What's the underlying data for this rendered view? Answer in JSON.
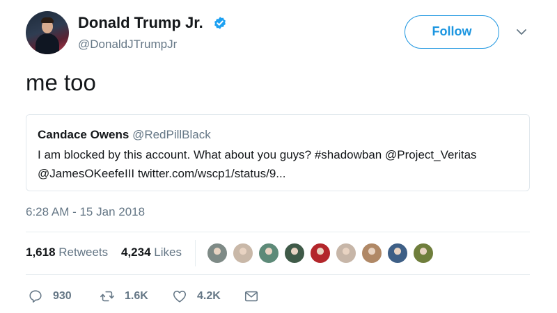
{
  "author": {
    "name": "Donald Trump Jr.",
    "handle": "@DonaldJTrumpJr",
    "verified": true
  },
  "follow_label": "Follow",
  "tweet_text": "me too",
  "quoted_tweet": {
    "name": "Candace Owens",
    "handle": "@RedPillBlack",
    "line1": "I am blocked by this account. What about you guys? #shadowban @Project_Veritas",
    "line2": "@JamesOKeefeIII twitter.com/wscp1/status/9..."
  },
  "timestamp": "6:28 AM - 15 Jan 2018",
  "stats": {
    "retweets_count": "1,618",
    "retweets_label": "Retweets",
    "likes_count": "4,234",
    "likes_label": "Likes"
  },
  "liker_avatars": [
    {
      "icon": "avatar-icon",
      "color": "#7e8a86"
    },
    {
      "icon": "avatar-icon",
      "color": "#c9b8a8"
    },
    {
      "icon": "avatar-icon",
      "color": "#5d8a78"
    },
    {
      "icon": "avatar-icon",
      "color": "#3f5a48"
    },
    {
      "icon": "avatar-icon",
      "color": "#b3262b"
    },
    {
      "icon": "avatar-icon",
      "color": "#c7b6a8"
    },
    {
      "icon": "avatar-icon",
      "color": "#b08866"
    },
    {
      "icon": "avatar-icon",
      "color": "#3e5f86"
    },
    {
      "icon": "avatar-icon",
      "color": "#6f7e3c"
    }
  ],
  "actions": {
    "replies": "930",
    "retweets": "1.6K",
    "likes": "4.2K"
  },
  "colors": {
    "accent": "#1b95e0",
    "secondary_text": "#657786",
    "verified": "#1da1f2"
  }
}
